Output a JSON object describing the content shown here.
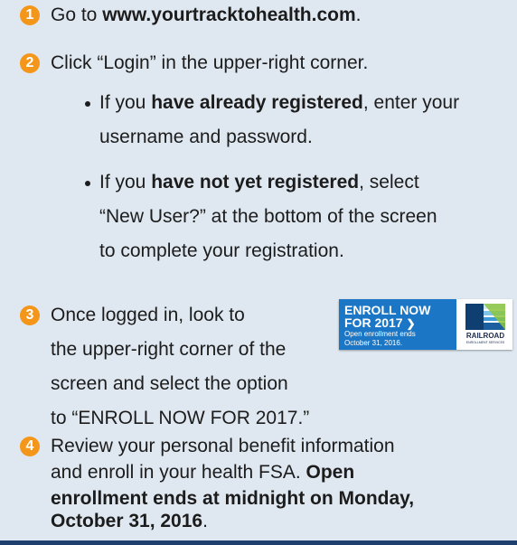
{
  "colors": {
    "background": "#dfe8f1",
    "badge": "#f39619",
    "banner": "#1b77c6",
    "bar": "#1f3f6e"
  },
  "steps": [
    {
      "number": "1",
      "lines": [
        {
          "a": "Go to ",
          "b": "www.yourtracktohealth.com",
          "c": "."
        }
      ]
    },
    {
      "number": "2",
      "lines": [
        {
          "a": "Click “Login” in the upper-right corner.",
          "b": "",
          "c": ""
        }
      ],
      "bullets": [
        {
          "lines": [
            {
              "a": "If you ",
              "b": "have already registered",
              "c": ", enter your"
            },
            {
              "a": "username and password.",
              "b": "",
              "c": ""
            }
          ]
        },
        {
          "lines": [
            {
              "a": "If you ",
              "b": "have not yet registered",
              "c": ", select"
            },
            {
              "a": "“New User?” at the bottom of the screen",
              "b": "",
              "c": ""
            },
            {
              "a": "to complete your registration.",
              "b": "",
              "c": ""
            }
          ]
        }
      ]
    },
    {
      "number": "3",
      "lines": [
        {
          "a": "Once logged in, look to",
          "b": "",
          "c": ""
        },
        {
          "a": "the upper-right corner of the",
          "b": "",
          "c": ""
        },
        {
          "a": "screen and select the option",
          "b": "",
          "c": ""
        },
        {
          "a": "to “ENROLL NOW FOR 2017.”",
          "b": "",
          "c": ""
        }
      ]
    },
    {
      "number": "4",
      "lines": [
        {
          "a": "Review your personal benefit information",
          "b": "",
          "c": ""
        },
        {
          "a": "and enroll in your health FSA. ",
          "b": "Open",
          "c": ""
        },
        {
          "a": "",
          "b": "enrollment ends at midnight on Monday,",
          "c": ""
        },
        {
          "a": "",
          "b": "October 31, 2016",
          "c": "."
        }
      ]
    }
  ],
  "banner": {
    "line1": "ENROLL NOW",
    "line2": "FOR 2017",
    "arrow": "❯",
    "sub1": "Open enrollment ends",
    "sub2": "October 31, 2016.",
    "logo_name": "RAILROAD",
    "logo_sub": "ENROLLMENT SERVICES",
    "logo_icon": "railroad-logo-icon"
  }
}
